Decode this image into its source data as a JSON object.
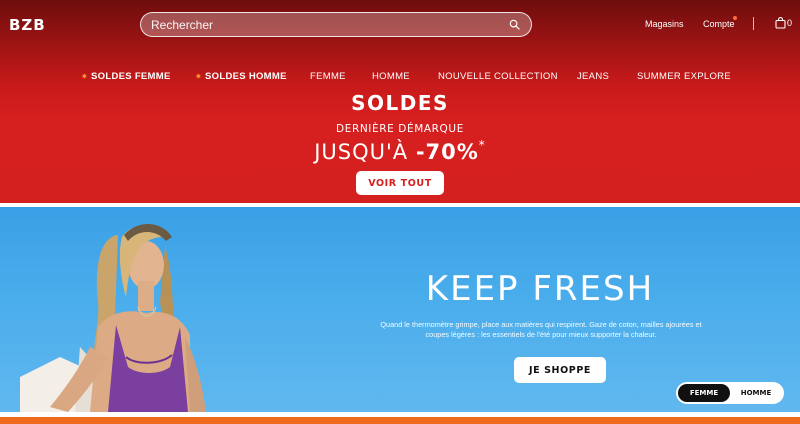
{
  "header": {
    "logo": "BZB",
    "search_placeholder": "Rechercher",
    "magasins": "Magasins",
    "compte": "Compte",
    "cart_count": "0"
  },
  "nav": {
    "items": [
      {
        "label": "SOLDES FEMME"
      },
      {
        "label": "SOLDES HOMME"
      },
      {
        "label": "FEMME"
      },
      {
        "label": "HOMME"
      },
      {
        "label": "NOUVELLE COLLECTION"
      },
      {
        "label": "JEANS"
      },
      {
        "label": "SUMMER EXPLORE"
      }
    ]
  },
  "promo": {
    "title": "SOLDES",
    "subtitle": "DERNIÈRE DÉMARQUE",
    "prefix": "JUSQU'À ",
    "percent": "-70%",
    "asterisk": "*",
    "button": "VOIR TOUT"
  },
  "fresh": {
    "title": "KEEP FRESH",
    "description": "Quand le thermomètre grimpe, place aux matières qui respirent. Gaze de coton, mailles ajourées et coupes légères : les essentiels de l'été pour mieux supporter la chaleur.",
    "button": "JE SHOPPE",
    "toggle_femme": "FEMME",
    "toggle_homme": "HOMME",
    "active_toggle": "FEMME"
  },
  "colors": {
    "promo_red": "#d52020",
    "sky_blue": "#48aceb",
    "accent_orange": "#f06a1e"
  }
}
